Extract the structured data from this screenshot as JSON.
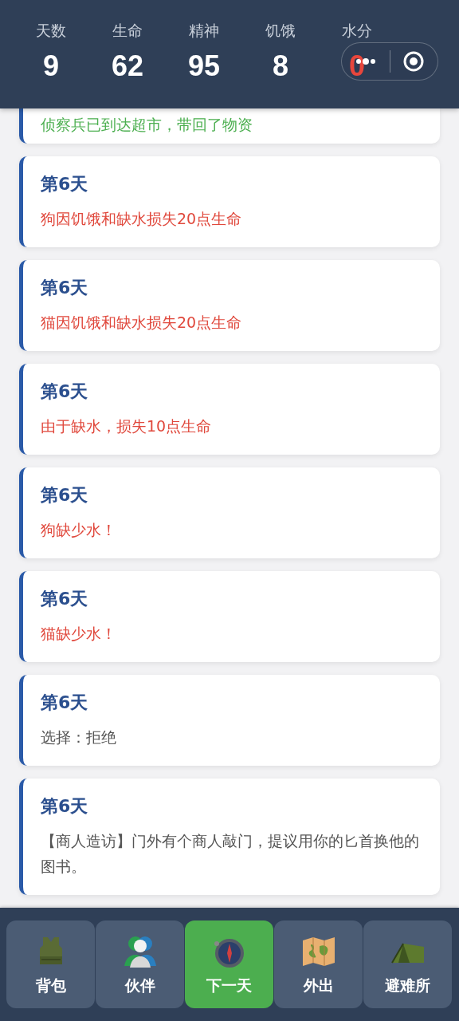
{
  "stats": [
    {
      "label": "天数",
      "value": "9",
      "alert": false
    },
    {
      "label": "生命",
      "value": "62",
      "alert": false
    },
    {
      "label": "精神",
      "value": "95",
      "alert": false
    },
    {
      "label": "饥饿",
      "value": "8",
      "alert": false
    },
    {
      "label": "水分",
      "value": "0",
      "alert": true
    }
  ],
  "log": [
    {
      "text": "侦察兵已到达超市，带回了物资",
      "color": "#4caf50"
    },
    {
      "day": "第6天",
      "text": "狗因饥饿和缺水损失20点生命",
      "color": "#e0483c"
    },
    {
      "day": "第6天",
      "text": "猫因饥饿和缺水损失20点生命",
      "color": "#e0483c"
    },
    {
      "day": "第6天",
      "text": "由于缺水，损失10点生命",
      "color": "#e0483c"
    },
    {
      "day": "第6天",
      "text": "狗缺少水！",
      "color": "#e0483c"
    },
    {
      "day": "第6天",
      "text": "猫缺少水！",
      "color": "#e0483c"
    },
    {
      "day": "第6天",
      "text": "选择：拒绝",
      "color": "#555555"
    },
    {
      "day": "第6天",
      "text": "【商人造访】门外有个商人敲门，提议用你的匕首换他的图书。",
      "color": "#555555"
    }
  ],
  "nav": [
    {
      "label": "背包",
      "selected": false
    },
    {
      "label": "伙伴",
      "selected": false
    },
    {
      "label": "下一天",
      "selected": true
    },
    {
      "label": "外出",
      "selected": false
    },
    {
      "label": "避难所",
      "selected": false
    }
  ]
}
